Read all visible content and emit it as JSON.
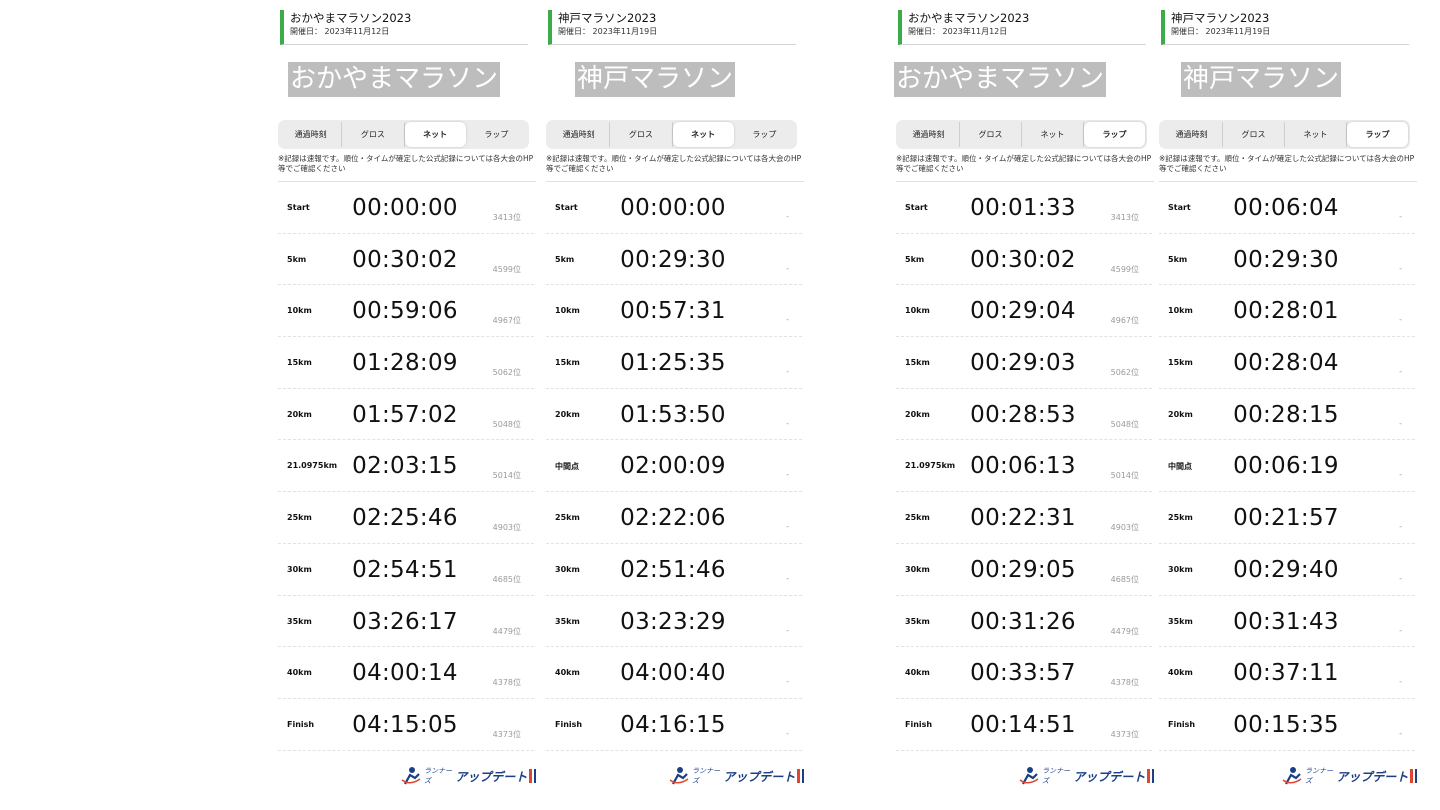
{
  "tabs_labels": [
    "通過時刻",
    "グロス",
    "ネット",
    "ラップ"
  ],
  "note": "※記録は速報です。順位・タイムが確定した公式記録については各大会のHP等でご確認ください",
  "logo": {
    "small": "ランナーズ",
    "main": "アップデート"
  },
  "panels": [
    {
      "event_title": "おかやまマラソン2023",
      "event_date": "開催日： 2023年11月12日",
      "big_name": "おかやまマラソン",
      "active_tab": "ネット",
      "splits": [
        {
          "point": "Start",
          "time": "00:00:00",
          "rank": "3413位"
        },
        {
          "point": "5km",
          "time": "00:30:02",
          "rank": "4599位"
        },
        {
          "point": "10km",
          "time": "00:59:06",
          "rank": "4967位"
        },
        {
          "point": "15km",
          "time": "01:28:09",
          "rank": "5062位"
        },
        {
          "point": "20km",
          "time": "01:57:02",
          "rank": "5048位"
        },
        {
          "point": "21.0975km",
          "time": "02:03:15",
          "rank": "5014位"
        },
        {
          "point": "25km",
          "time": "02:25:46",
          "rank": "4903位"
        },
        {
          "point": "30km",
          "time": "02:54:51",
          "rank": "4685位"
        },
        {
          "point": "35km",
          "time": "03:26:17",
          "rank": "4479位"
        },
        {
          "point": "40km",
          "time": "04:00:14",
          "rank": "4378位"
        },
        {
          "point": "Finish",
          "time": "04:15:05",
          "rank": "4373位"
        }
      ]
    },
    {
      "event_title": "神戸マラソン2023",
      "event_date": "開催日： 2023年11月19日",
      "big_name": "神戸マラソン",
      "active_tab": "ネット",
      "splits": [
        {
          "point": "Start",
          "time": "00:00:00",
          "rank": "-"
        },
        {
          "point": "5km",
          "time": "00:29:30",
          "rank": "-"
        },
        {
          "point": "10km",
          "time": "00:57:31",
          "rank": "-"
        },
        {
          "point": "15km",
          "time": "01:25:35",
          "rank": "-"
        },
        {
          "point": "20km",
          "time": "01:53:50",
          "rank": "-"
        },
        {
          "point": "中間点",
          "time": "02:00:09",
          "rank": "-"
        },
        {
          "point": "25km",
          "time": "02:22:06",
          "rank": "-"
        },
        {
          "point": "30km",
          "time": "02:51:46",
          "rank": "-"
        },
        {
          "point": "35km",
          "time": "03:23:29",
          "rank": "-"
        },
        {
          "point": "40km",
          "time": "04:00:40",
          "rank": "-"
        },
        {
          "point": "Finish",
          "time": "04:16:15",
          "rank": "-"
        }
      ]
    },
    {
      "event_title": "おかやまマラソン2023",
      "event_date": "開催日： 2023年11月12日",
      "big_name": "おかやまマラソン",
      "active_tab": "ラップ",
      "splits": [
        {
          "point": "Start",
          "time": "00:01:33",
          "rank": "3413位"
        },
        {
          "point": "5km",
          "time": "00:30:02",
          "rank": "4599位"
        },
        {
          "point": "10km",
          "time": "00:29:04",
          "rank": "4967位"
        },
        {
          "point": "15km",
          "time": "00:29:03",
          "rank": "5062位"
        },
        {
          "point": "20km",
          "time": "00:28:53",
          "rank": "5048位"
        },
        {
          "point": "21.0975km",
          "time": "00:06:13",
          "rank": "5014位"
        },
        {
          "point": "25km",
          "time": "00:22:31",
          "rank": "4903位"
        },
        {
          "point": "30km",
          "time": "00:29:05",
          "rank": "4685位"
        },
        {
          "point": "35km",
          "time": "00:31:26",
          "rank": "4479位"
        },
        {
          "point": "40km",
          "time": "00:33:57",
          "rank": "4378位"
        },
        {
          "point": "Finish",
          "time": "00:14:51",
          "rank": "4373位"
        }
      ]
    },
    {
      "event_title": "神戸マラソン2023",
      "event_date": "開催日： 2023年11月19日",
      "big_name": "神戸マラソン",
      "active_tab": "ラップ",
      "splits": [
        {
          "point": "Start",
          "time": "00:06:04",
          "rank": "-"
        },
        {
          "point": "5km",
          "time": "00:29:30",
          "rank": "-"
        },
        {
          "point": "10km",
          "time": "00:28:01",
          "rank": "-"
        },
        {
          "point": "15km",
          "time": "00:28:04",
          "rank": "-"
        },
        {
          "point": "20km",
          "time": "00:28:15",
          "rank": "-"
        },
        {
          "point": "中間点",
          "time": "00:06:19",
          "rank": "-"
        },
        {
          "point": "25km",
          "time": "00:21:57",
          "rank": "-"
        },
        {
          "point": "30km",
          "time": "00:29:40",
          "rank": "-"
        },
        {
          "point": "35km",
          "time": "00:31:43",
          "rank": "-"
        },
        {
          "point": "40km",
          "time": "00:37:11",
          "rank": "-"
        },
        {
          "point": "Finish",
          "time": "00:15:35",
          "rank": "-"
        }
      ]
    }
  ]
}
